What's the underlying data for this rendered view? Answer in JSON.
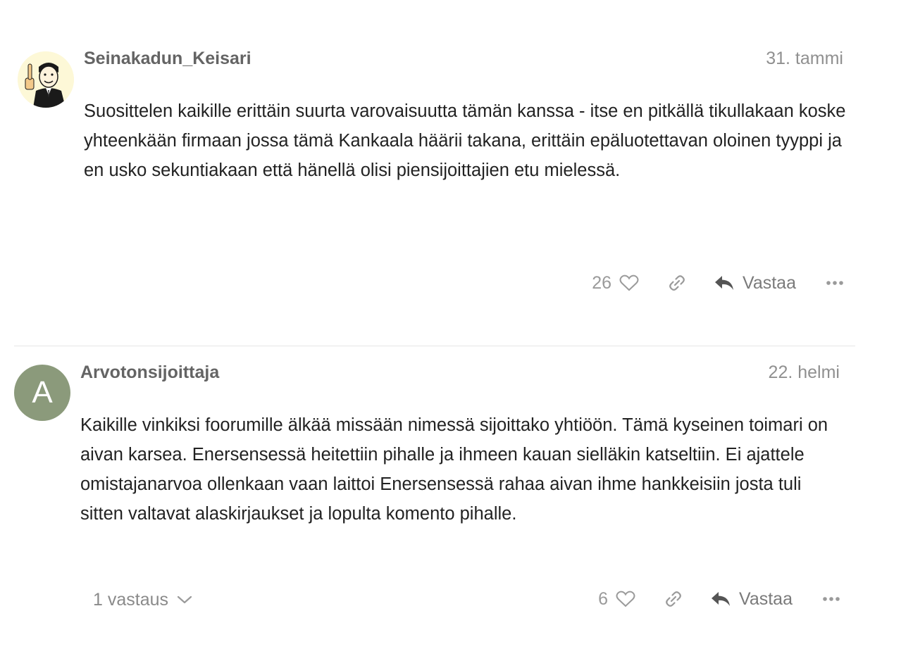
{
  "posts": [
    {
      "username": "Seinakadun_Keisari",
      "date": "31. tammi",
      "avatar_icon": "cartoon-man-avatar-icon",
      "body": "Suosittelen kaikille erittäin suurta varovaisuutta tämän kanssa - itse en pitkällä tikullakaan koske yhteenkään firmaan jossa tämä Kankaala häärii takana, erittäin epäluotettavan oloinen tyyppi ja en usko sekuntiakaan että hänellä olisi piensijoittajien etu mielessä.",
      "likes": "26",
      "reply_label": "Vastaa"
    },
    {
      "username": "Arvotonsijoittaja",
      "date": "22. helmi",
      "avatar_letter": "A",
      "avatar_color": "#8b9a7b",
      "body": "Kaikille vinkiksi foorumille älkää missään nimessä sijoittako yhtiöön. Tämä kyseinen toimari on aivan karsea. Enersensessä heitettiin pihalle ja ihmeen kauan sielläkin katseltiin. Ei ajattele omistajanarvoa ollenkaan vaan laittoi Enersensessä rahaa aivan ihme hankkeisiin josta tuli sitten valtavat alaskirjaukset ja lopulta komento pihalle.",
      "likes": "6",
      "reply_label": "Vastaa",
      "replies_toggle": "1 vastaus"
    }
  ],
  "icons": {
    "like": "heart-icon",
    "link": "link-icon",
    "reply": "reply-arrow-icon",
    "more": "more-dots-icon",
    "expand": "chevron-down-icon"
  }
}
